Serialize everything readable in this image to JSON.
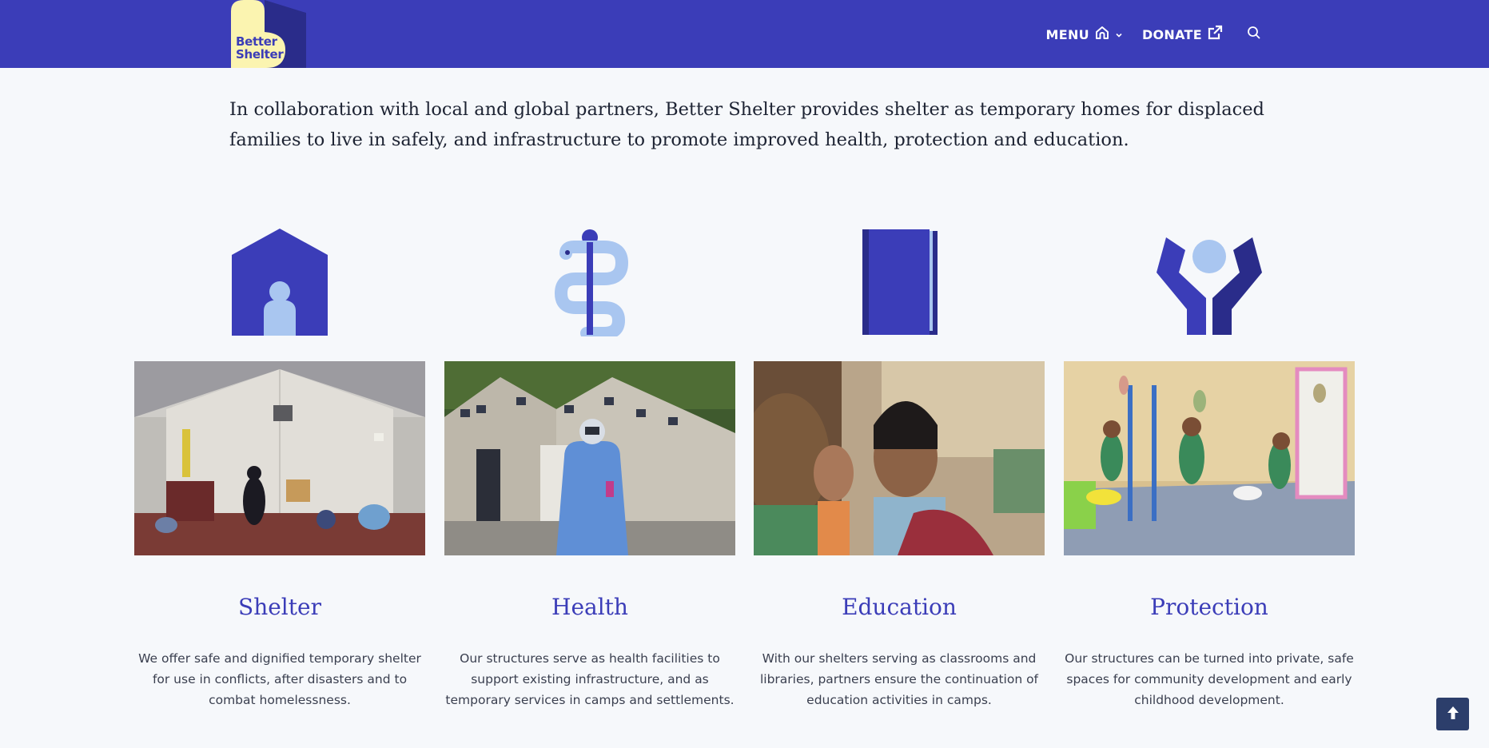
{
  "header": {
    "logo": {
      "line1": "Better",
      "line2": "Shelter"
    },
    "nav": {
      "menu_label": "MENU",
      "donate_label": "DONATE"
    }
  },
  "intro": {
    "text": "In collaboration with local and global partners, Better Shelter provides shelter as temporary homes for displaced families to live in safely, and infrastructure to promote improved health, protection and education."
  },
  "columns": [
    {
      "icon": "house-person-icon",
      "title": "Shelter",
      "description": "We offer safe and dignified temporary shelter for use in conflicts, after disasters and to combat homelessness."
    },
    {
      "icon": "caduceus-icon",
      "title": "Health",
      "description": "Our structures serve as health facilities to support existing infrastructure, and as temporary services in camps and settlements."
    },
    {
      "icon": "book-icon",
      "title": "Education",
      "description": "With our shelters serving as classrooms and libraries, partners ensure the continuation of education activities in camps."
    },
    {
      "icon": "protective-hands-icon",
      "title": "Protection",
      "description": "Our structures can be turned into private, safe spaces for community development and early childhood development."
    }
  ],
  "colors": {
    "brand_blue": "#3b3db8",
    "light_blue": "#a9c6f0",
    "dark_blue": "#2a2c8a",
    "logo_yellow": "#fbf4b0",
    "background": "#f6f8fb"
  }
}
